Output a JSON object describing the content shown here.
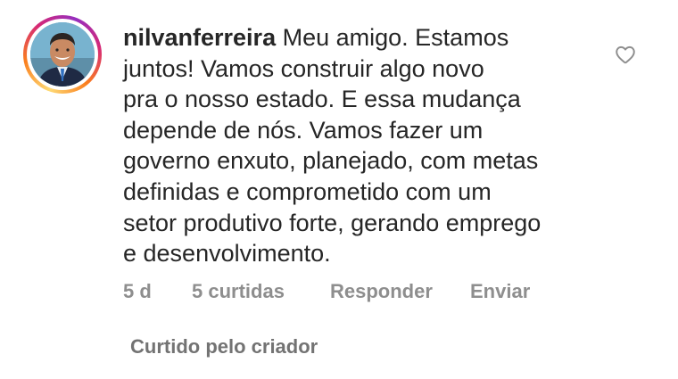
{
  "comment": {
    "username": "nilvanferreira",
    "text_lines": [
      "Meu amigo. Estamos",
      "juntos! Vamos construir algo novo",
      "pra o nosso estado. E essa mudança",
      "depende de nós. Vamos fazer um",
      "governo enxuto, planejado, com metas",
      "definidas e comprometido com um",
      "setor produtivo forte, gerando emprego",
      "e desenvolvimento."
    ],
    "timestamp": "5 d",
    "likes": "5 curtidas",
    "reply_label": "Responder",
    "send_label": "Enviar",
    "liked_by_creator": "Curtido pelo criador"
  },
  "icons": {
    "like": "heart-icon"
  },
  "colors": {
    "text": "#262626",
    "meta": "#8e8e8e",
    "story_ring_start": "#feda75",
    "story_ring_end": "#962fbf"
  }
}
